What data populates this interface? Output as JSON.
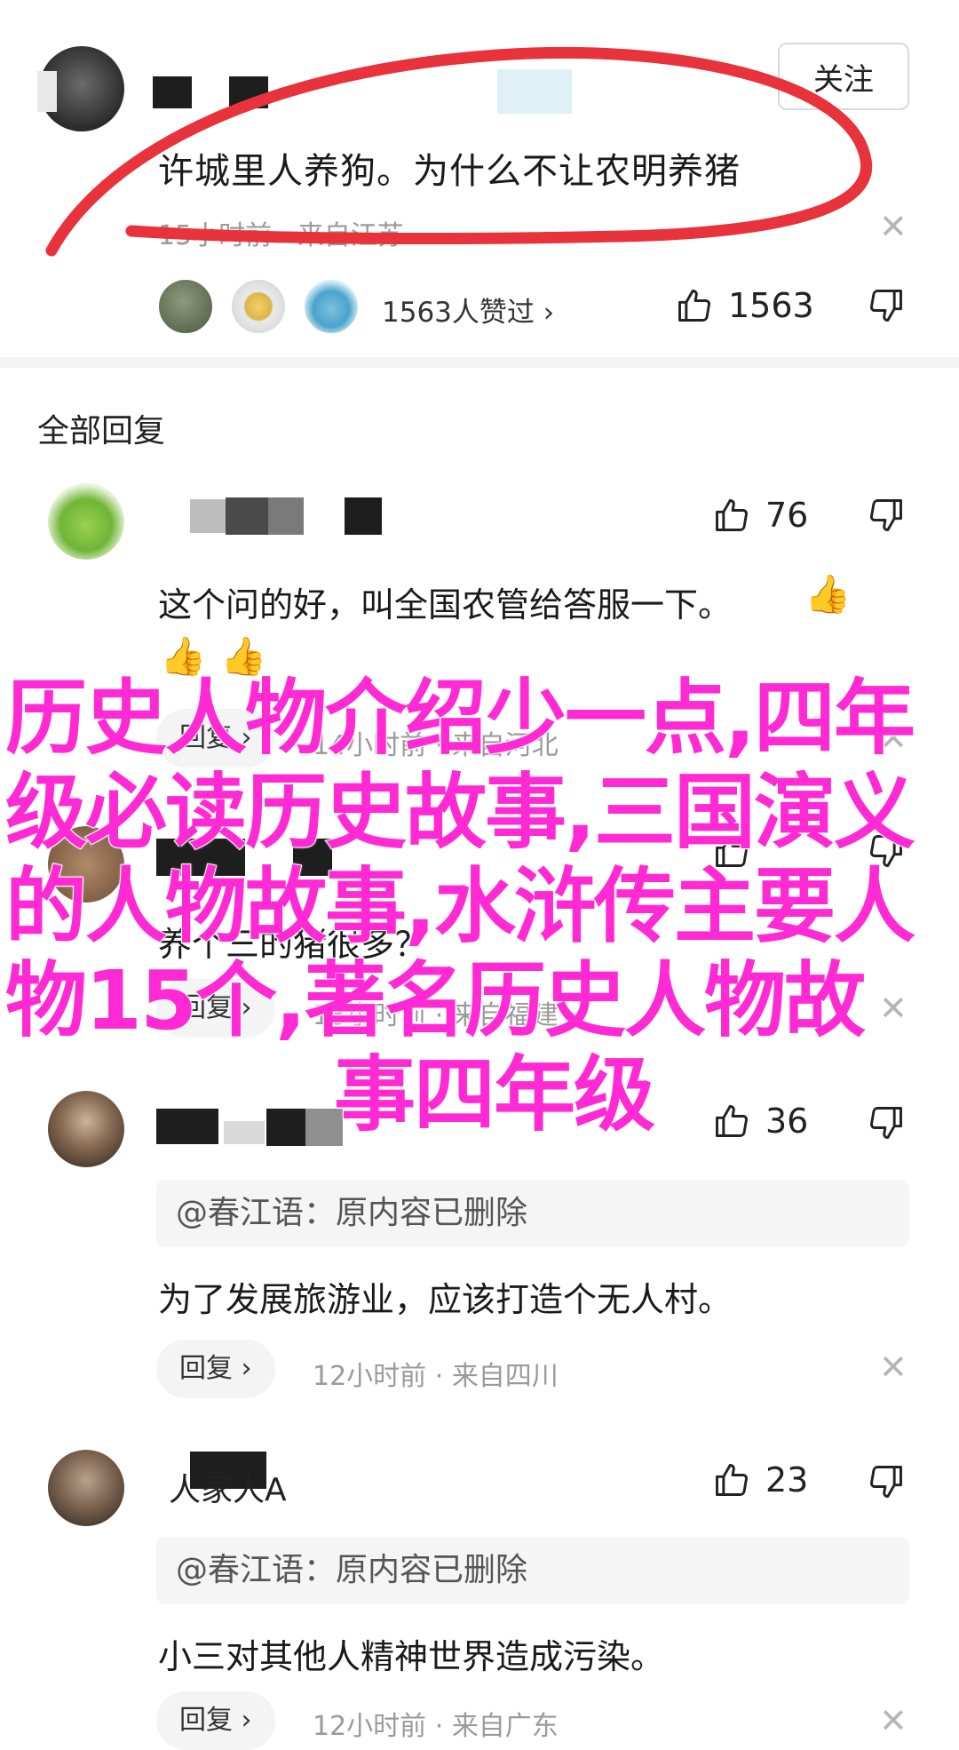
{
  "main_comment": {
    "follow_label": "关注",
    "text": "许城里人养狗。为什么不让农明养猪",
    "time": "15小时前",
    "location": "来自江苏",
    "likers_text": "1563人赞过",
    "likes": "1563"
  },
  "section_title": "全部回复",
  "replies": [
    {
      "text": "这个问的好，叫全国农管给答服一下。",
      "likes": "76",
      "reply_label": "回复",
      "time": "14小时前",
      "location": "来自河北"
    },
    {
      "text": "养个三的猪很多？",
      "reply_label": "回复",
      "time": "13小时前",
      "location": "来自福建"
    },
    {
      "quote": "@春江语：原内容已删除",
      "text": "为了发展旅游业，应该打造个无人村。",
      "likes": "36",
      "reply_label": "回复",
      "time": "12小时前",
      "location": "来自四川"
    },
    {
      "username": "人家人A",
      "quote": "@春江语：原内容已删除",
      "text": "小三对其他人精神世界造成污染。",
      "likes": "23",
      "reply_label": "回复",
      "time": "12小时前",
      "location": "来自广东"
    }
  ],
  "overlay_title": {
    "line1": "历史人物介绍少一点,四年",
    "line2": "级必读历史故事,三国演义",
    "line3": "的人物故事,水浒传主要人",
    "line4": "物15个,著名历史人物故",
    "line5": "事四年级"
  },
  "colors": {
    "overlay_pink": "#ff2ad4",
    "annotation_red": "#e8323c",
    "meta_grey": "#9a9a9a"
  }
}
